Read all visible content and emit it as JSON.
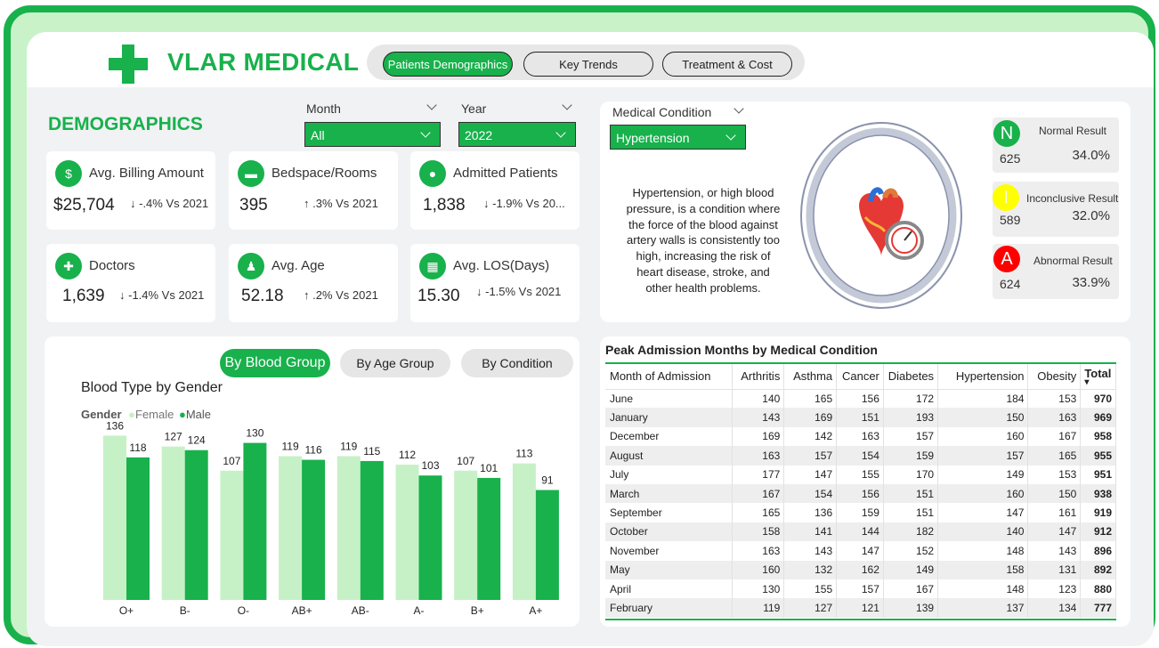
{
  "brand": {
    "name": "VLAR MEDICAL",
    "color": "#18b14c"
  },
  "nav": {
    "tabs": [
      {
        "label": "Patients Demographics",
        "active": true
      },
      {
        "label": "Key Trends",
        "active": false
      },
      {
        "label": "Treatment & Cost",
        "active": false
      }
    ]
  },
  "demographics": {
    "title": "DEMOGRAPHICS",
    "month_filter": {
      "label": "Month",
      "value": "All"
    },
    "year_filter": {
      "label": "Year",
      "value": "2022"
    },
    "kpis": [
      {
        "label": "Avg. Billing Amount",
        "value": "$25,704",
        "change": "↓ -.4% Vs 2021",
        "icon": "money-bag-icon"
      },
      {
        "label": "Bedspace/Rooms",
        "value": "395",
        "change": "↑ .3% Vs 2021",
        "icon": "bed-icon"
      },
      {
        "label": "Admitted Patients",
        "value": "1,838",
        "change": "↓ -1.9% Vs 20...",
        "icon": "patient-icon"
      },
      {
        "label": "Doctors",
        "value": "1,639",
        "change": "↓ -1.4% Vs 2021",
        "icon": "doctor-icon"
      },
      {
        "label": "Avg. Age",
        "value": "52.18",
        "change": "↑ .2% Vs 2021",
        "icon": "family-icon"
      },
      {
        "label": "Avg. LOS(Days)",
        "value": "15.30",
        "change": "↓ -1.5% Vs 2021",
        "icon": "calendar-icon"
      }
    ]
  },
  "condition": {
    "filter_label": "Medical Condition",
    "filter_value": "Hypertension",
    "description": "Hypertension, or high blood pressure, is a condition where the force of the blood against artery walls is consistently too high, increasing the risk of heart disease, stroke, and other health problems.",
    "image_icon": "heart-pressure-gauge-icon"
  },
  "results": [
    {
      "letter": "N",
      "label": "Normal Result",
      "count": "625",
      "pct": "34.0%",
      "color": "#18b14c",
      "text_color": "#ffffff"
    },
    {
      "letter": "I",
      "label": "Inconclusive Result",
      "count": "589",
      "pct": "32.0%",
      "color": "#ffff00",
      "text_color": "#ffffff"
    },
    {
      "letter": "A",
      "label": "Abnormal Result",
      "count": "624",
      "pct": "33.9%",
      "color": "#ff0000",
      "text_color": "#ffffff"
    }
  ],
  "chart_tabs": [
    {
      "label": "By Blood Group",
      "active": true
    },
    {
      "label": "By Age Group",
      "active": false
    },
    {
      "label": "By Condition",
      "active": false
    }
  ],
  "chart_data": {
    "type": "bar",
    "title": "Blood Type by Gender",
    "legend_title": "Gender",
    "legend_position": "top-left",
    "categories": [
      "O+",
      "B-",
      "O-",
      "AB+",
      "AB-",
      "A-",
      "B+",
      "A+"
    ],
    "series": [
      {
        "name": "Female",
        "values": [
          136,
          127,
          107,
          119,
          119,
          112,
          107,
          113
        ],
        "color": "#c6f1c6"
      },
      {
        "name": "Male",
        "values": [
          118,
          124,
          130,
          116,
          115,
          103,
          101,
          91
        ],
        "color": "#18b14c"
      }
    ],
    "ylim": [
      0,
      140
    ],
    "grid": false
  },
  "table": {
    "title": "Peak Admission Months by Medical Condition",
    "columns": [
      "Month of Admission",
      "Arthritis",
      "Asthma",
      "Cancer",
      "Diabetes",
      "Hypertension",
      "Obesity",
      "Total"
    ],
    "rows": [
      [
        "June",
        "140",
        "165",
        "156",
        "172",
        "184",
        "153",
        "970"
      ],
      [
        "January",
        "143",
        "169",
        "151",
        "193",
        "150",
        "163",
        "969"
      ],
      [
        "December",
        "169",
        "142",
        "163",
        "157",
        "160",
        "167",
        "958"
      ],
      [
        "August",
        "163",
        "157",
        "154",
        "159",
        "157",
        "165",
        "955"
      ],
      [
        "July",
        "177",
        "147",
        "155",
        "170",
        "149",
        "153",
        "951"
      ],
      [
        "March",
        "167",
        "154",
        "156",
        "151",
        "160",
        "150",
        "938"
      ],
      [
        "September",
        "165",
        "136",
        "159",
        "151",
        "147",
        "161",
        "919"
      ],
      [
        "October",
        "158",
        "141",
        "144",
        "182",
        "140",
        "147",
        "912"
      ],
      [
        "November",
        "163",
        "143",
        "147",
        "152",
        "148",
        "143",
        "896"
      ],
      [
        "May",
        "160",
        "132",
        "162",
        "149",
        "158",
        "131",
        "892"
      ],
      [
        "April",
        "130",
        "155",
        "157",
        "167",
        "148",
        "123",
        "880"
      ],
      [
        "February",
        "119",
        "127",
        "121",
        "139",
        "137",
        "134",
        "777"
      ]
    ]
  }
}
